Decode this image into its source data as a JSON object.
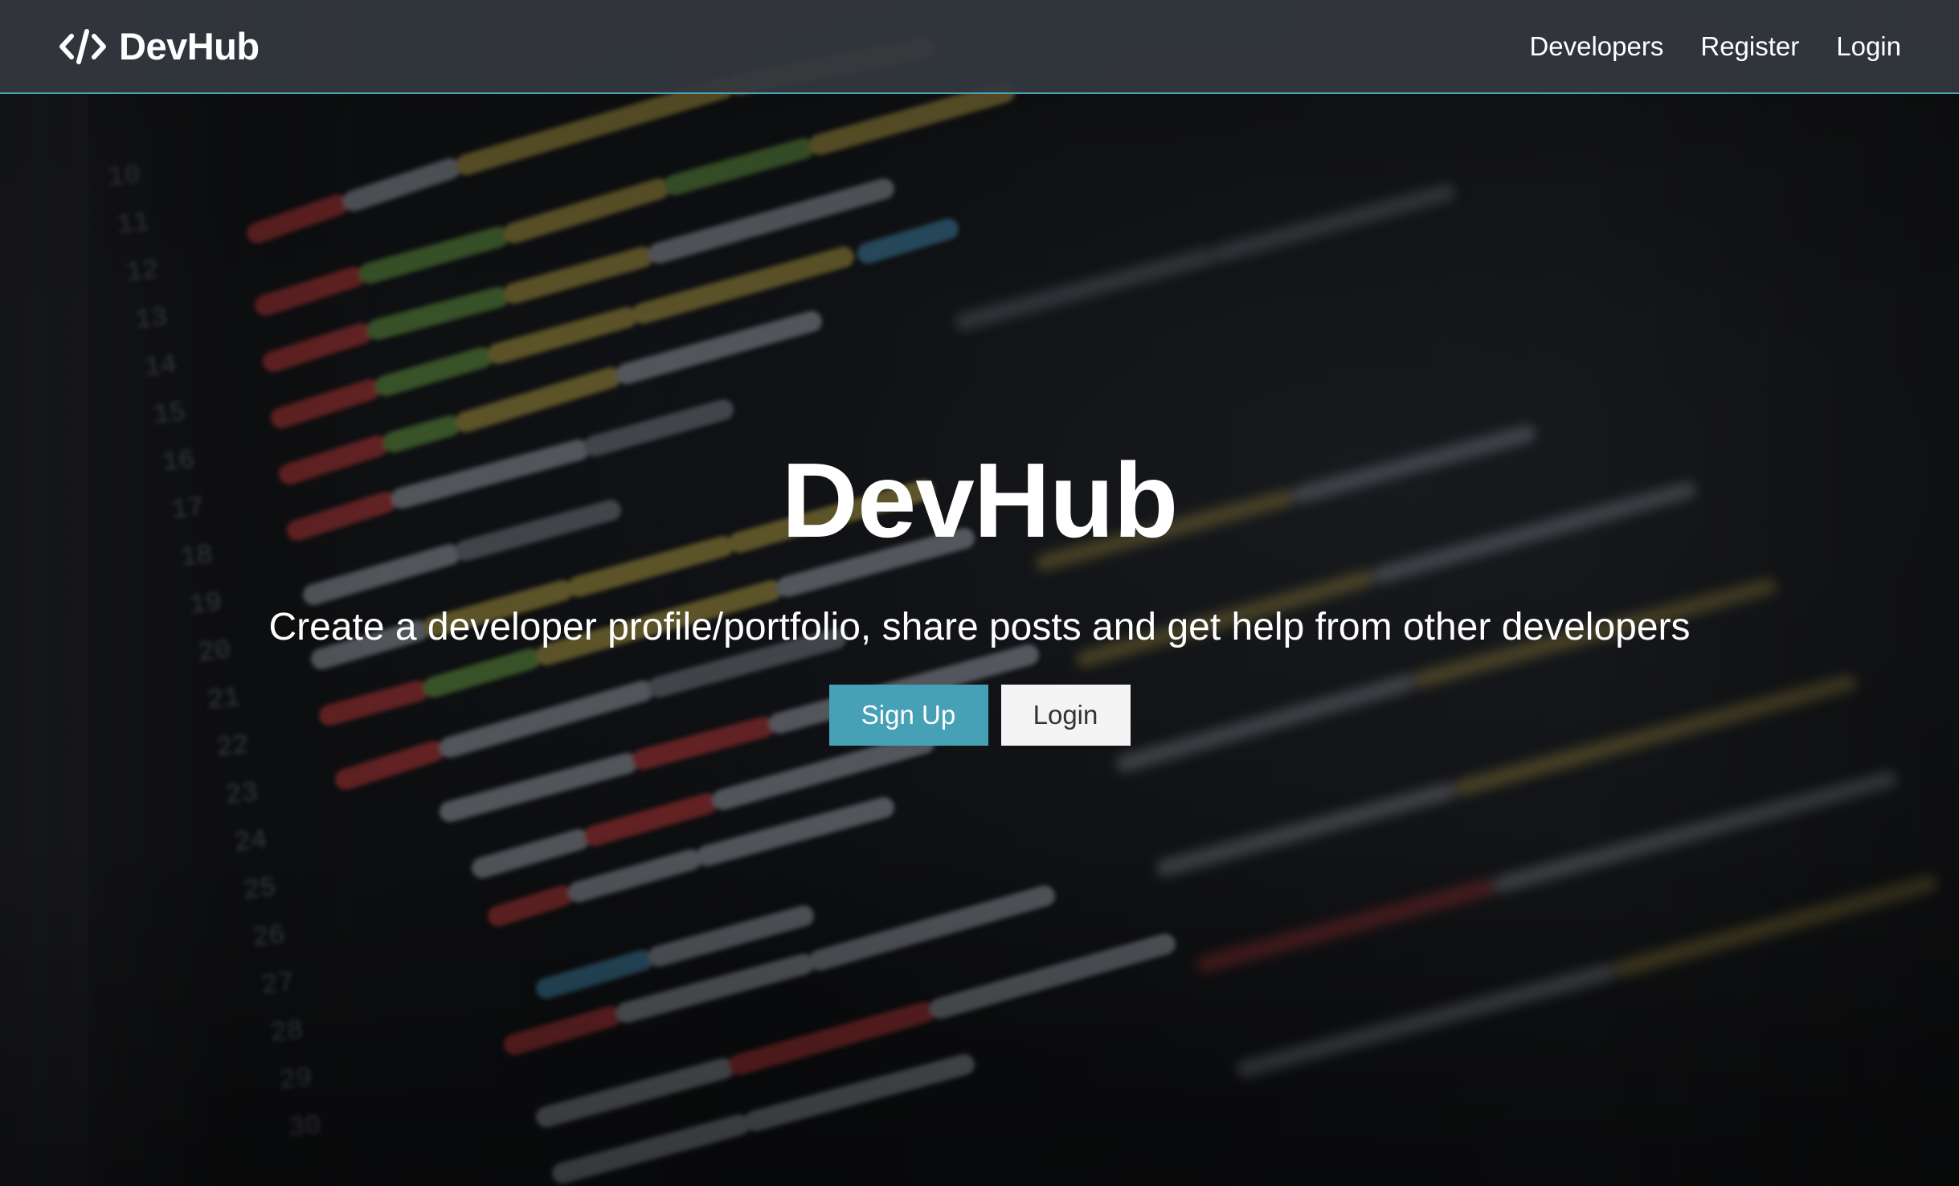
{
  "navbar": {
    "brand_icon": "code-icon",
    "brand_text": "DevHub",
    "links": [
      {
        "label": "Developers"
      },
      {
        "label": "Register"
      },
      {
        "label": "Login"
      }
    ]
  },
  "hero": {
    "title": "DevHub",
    "lead": "Create a developer profile/portfolio, share posts and get help from other developers",
    "primary_button": "Sign Up",
    "secondary_button": "Login"
  },
  "colors": {
    "accent": "#46a0b6",
    "navbar_bg": "#34383e",
    "navbar_border": "#4aa3b8",
    "text": "#ffffff",
    "light_button_bg": "#f4f4f4"
  }
}
